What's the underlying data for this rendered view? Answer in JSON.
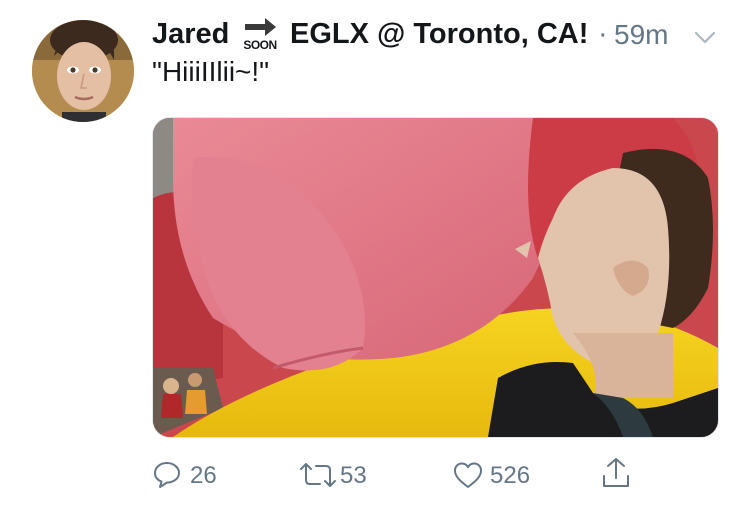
{
  "tweet": {
    "author_name_part1": "Jared",
    "emoji_label": "SOON",
    "author_name_part2": "EGLX @ Toronto, CA!",
    "separator": "·",
    "timestamp": "59m",
    "text": "\"HiiiIIlii~!\""
  },
  "actions": {
    "reply_count": "26",
    "retweet_count": "53",
    "like_count": "526"
  },
  "icons": {
    "reply": "reply-icon",
    "retweet": "retweet-icon",
    "like": "heart-icon",
    "share": "share-icon",
    "more": "chevron-down-icon"
  },
  "colors": {
    "text_primary": "#14171a",
    "text_secondary": "#657786",
    "border": "#e1e8ed"
  }
}
